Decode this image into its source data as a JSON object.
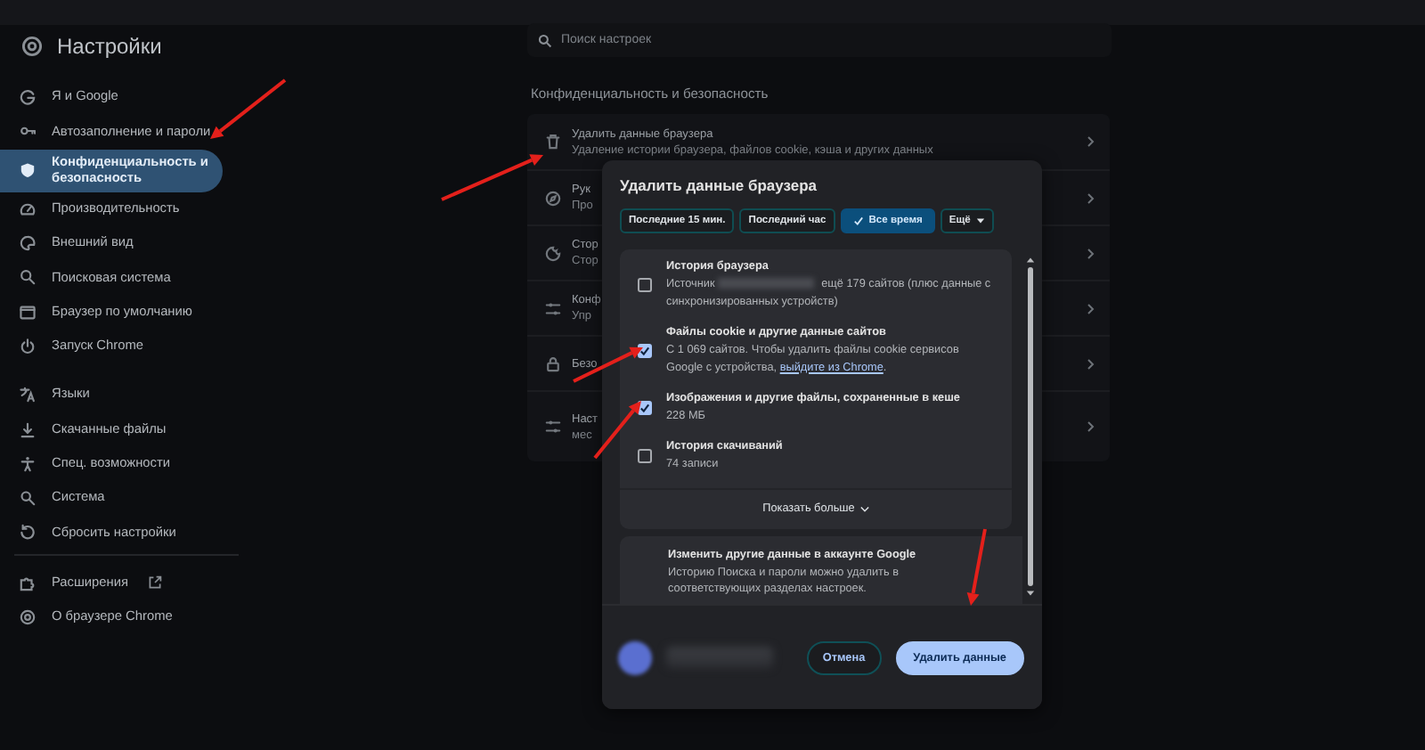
{
  "header": {
    "title": "Настройки"
  },
  "search": {
    "placeholder": "Поиск настроек"
  },
  "sidebar": {
    "sections": [
      {
        "items": [
          {
            "label": "Я и Google",
            "selected": false,
            "external": false
          },
          {
            "label": "Автозаполнение и пароли",
            "selected": false,
            "external": false
          },
          {
            "label": "Конфиденциальность и безопасность",
            "selected": true,
            "external": false
          },
          {
            "label": "Производительность",
            "selected": false,
            "external": false
          },
          {
            "label": "Внешний вид",
            "selected": false,
            "external": false
          },
          {
            "label": "Поисковая система",
            "selected": false,
            "external": false
          },
          {
            "label": "Браузер по умолчанию",
            "selected": false,
            "external": false
          },
          {
            "label": "Запуск Chrome",
            "selected": false,
            "external": false
          }
        ]
      },
      {
        "items": [
          {
            "label": "Языки",
            "selected": false,
            "external": false
          },
          {
            "label": "Скачанные файлы",
            "selected": false,
            "external": false
          },
          {
            "label": "Спец. возможности",
            "selected": false,
            "external": false
          },
          {
            "label": "Система",
            "selected": false,
            "external": false
          },
          {
            "label": "Сбросить настройки",
            "selected": false,
            "external": false
          }
        ]
      },
      {
        "items": [
          {
            "label": "Расширения",
            "selected": false,
            "external": true
          },
          {
            "label": "О браузере Chrome",
            "selected": false,
            "external": false
          }
        ]
      }
    ]
  },
  "section_title": "Конфиденциальность и безопасность",
  "rows": [
    {
      "title": "Удалить данные браузера",
      "subtitle": "Удаление истории браузера, файлов cookie, кэша и других данных"
    },
    {
      "title": "Рук",
      "subtitle": "Про"
    },
    {
      "title": "Стор",
      "subtitle": "Стор"
    },
    {
      "title": "Конф",
      "subtitle": "Упр"
    },
    {
      "title": "Безо"
    },
    {
      "title": "Наст",
      "subtitle": "мес"
    }
  ],
  "dialog": {
    "title": "Удалить данные браузера",
    "time_ranges": [
      {
        "label": "Последние 15 мин.",
        "kind": "chip",
        "selected": false
      },
      {
        "label": "Последний час",
        "kind": "chip",
        "selected": false
      },
      {
        "label": "Все время",
        "kind": "chip",
        "selected": true
      },
      {
        "label": "Ещё",
        "kind": "dropdown",
        "selected": false
      }
    ],
    "items": [
      {
        "title": "История браузера",
        "description": "Источник",
        "redacted": true,
        "description_end": "ещё 179 сайтов (плюс данные с синхронизированных устройств)",
        "checked": false
      },
      {
        "title": "Файлы cookie и другие данные сайтов",
        "description": "С 1 069 сайтов. Чтобы удалить файлы cookie сервисов Google с устройства,",
        "link": "выйдите из Chrome",
        "description_end": ".",
        "checked": true
      },
      {
        "title": "Изображения и другие файлы, сохраненные в кеше",
        "description": "228 МБ",
        "checked": true
      },
      {
        "title": "История скачиваний",
        "description": "74 записи",
        "checked": false
      }
    ],
    "show_more": "Показать больше",
    "account_card": {
      "title": "Изменить другие данные в аккаунте Google",
      "description": "Историю Поиска и пароли можно удалить в соответствующих разделах настроек."
    },
    "buttons": [
      {
        "label": "Отмена",
        "kind": "secondary"
      },
      {
        "label": "Удалить данные",
        "kind": "primary"
      }
    ]
  }
}
